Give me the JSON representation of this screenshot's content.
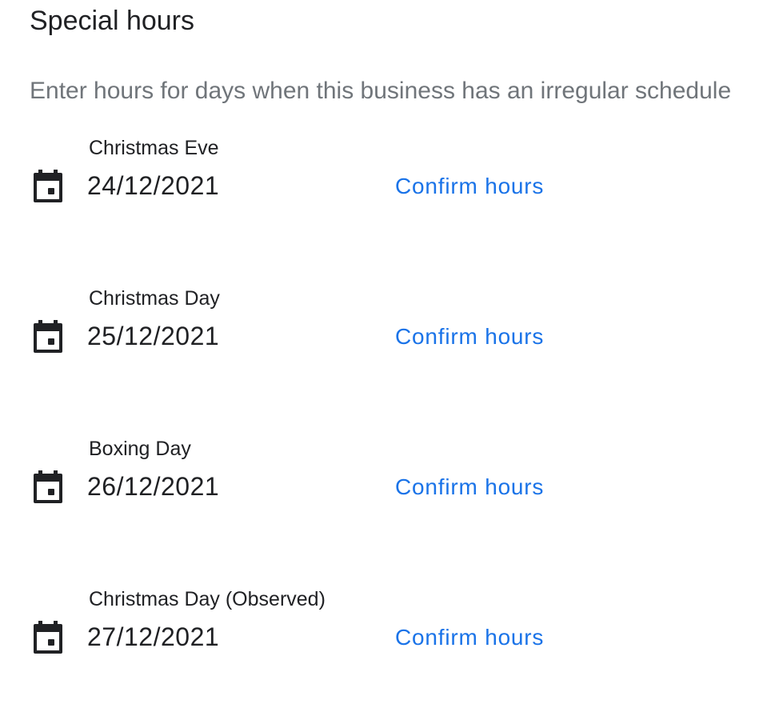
{
  "section": {
    "title": "Special hours",
    "subtitle": "Enter hours for days when this business has an irregular schedule"
  },
  "entries": [
    {
      "name": "Christmas Eve",
      "date": "24/12/2021",
      "action_label": "Confirm hours",
      "icon": "calendar-icon"
    },
    {
      "name": "Christmas Day",
      "date": "25/12/2021",
      "action_label": "Confirm hours",
      "icon": "calendar-icon"
    },
    {
      "name": "Boxing Day",
      "date": "26/12/2021",
      "action_label": "Confirm hours",
      "icon": "calendar-icon"
    },
    {
      "name": "Christmas Day (Observed)",
      "date": "27/12/2021",
      "action_label": "Confirm hours",
      "icon": "calendar-icon"
    }
  ],
  "colors": {
    "link": "#1a73e8",
    "primary_text": "#202124",
    "secondary_text": "#70757a"
  }
}
